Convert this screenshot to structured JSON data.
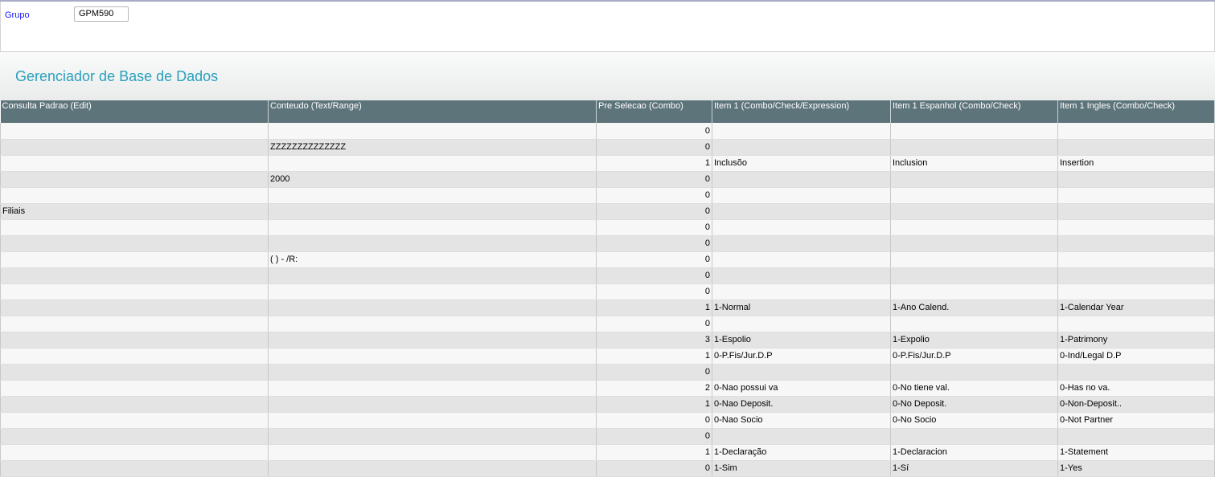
{
  "filter": {
    "label": "Grupo",
    "value": "GPM590"
  },
  "page": {
    "title": "Gerenciador de Base de Dados"
  },
  "table": {
    "columns": [
      "Consulta Padrao (Edit)",
      "Conteudo (Text/Range)",
      "Pre Selecao (Combo)",
      "Item 1 (Combo/Check/Expression)",
      "Item 1 Espanhol (Combo/Check)",
      "Item 1 Ingles (Combo/Check)"
    ],
    "rows": [
      [
        "",
        "",
        "0",
        "",
        "",
        ""
      ],
      [
        "",
        "ZZZZZZZZZZZZZZ",
        "0",
        "",
        "",
        ""
      ],
      [
        "",
        "",
        "1",
        "Inclusõo",
        "Inclusion",
        "Insertion"
      ],
      [
        "",
        "2000",
        "0",
        "",
        "",
        ""
      ],
      [
        "",
        "",
        "0",
        "",
        "",
        ""
      ],
      [
        "Filiais",
        "",
        "0",
        "",
        "",
        ""
      ],
      [
        "",
        "",
        "0",
        "",
        "",
        ""
      ],
      [
        "",
        "",
        "0",
        "",
        "",
        ""
      ],
      [
        "",
        "(    )    -    /R:",
        "0",
        "",
        "",
        ""
      ],
      [
        "",
        "",
        "0",
        "",
        "",
        ""
      ],
      [
        "",
        "",
        "0",
        "",
        "",
        ""
      ],
      [
        "",
        "",
        "1",
        "1-Normal",
        "1-Ano Calend.",
        "1-Calendar Year"
      ],
      [
        "",
        "",
        "0",
        "",
        "",
        ""
      ],
      [
        "",
        "",
        "3",
        "1-Espolio",
        "1-Expolio",
        "1-Patrimony"
      ],
      [
        "",
        "",
        "1",
        "0-P.Fis/Jur.D.P",
        "0-P.Fis/Jur.D.P",
        "0-Ind/Legal D.P"
      ],
      [
        "",
        "",
        "0",
        "",
        "",
        ""
      ],
      [
        "",
        "",
        "2",
        "0-Nao possui va",
        "0-No tiene val.",
        "0-Has no va."
      ],
      [
        "",
        "",
        "1",
        "0-Nao Deposit.",
        "0-No Deposit.",
        "0-Non-Deposit.."
      ],
      [
        "",
        "",
        "0",
        "0-Nao Socio",
        "0-No Socio",
        "0-Not Partner"
      ],
      [
        "",
        "",
        "0",
        "",
        "",
        ""
      ],
      [
        "",
        "",
        "1",
        "1-Declaração",
        "1-Declaracion",
        "1-Statement"
      ],
      [
        "",
        "",
        "0",
        "1-Sim",
        "1-Sí",
        "1-Yes"
      ]
    ]
  }
}
